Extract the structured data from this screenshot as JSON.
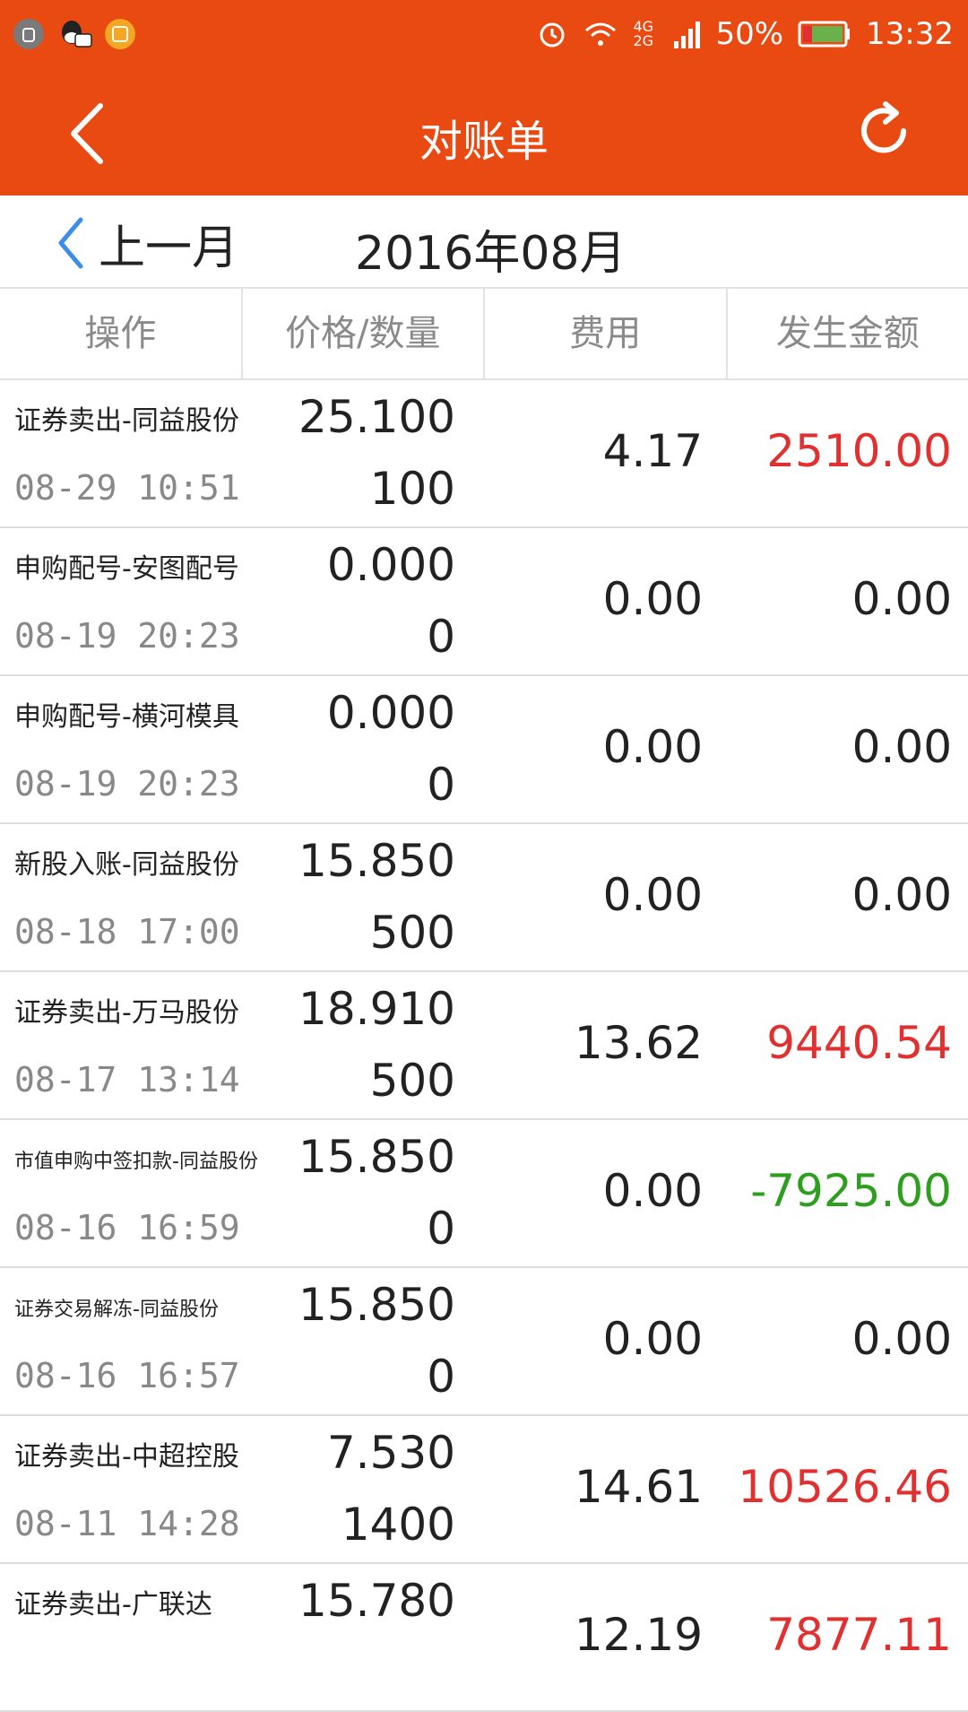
{
  "status_bar": {
    "battery": "50%",
    "time": "13:32",
    "network": "4G 2G",
    "icons": [
      "android-debug-icon",
      "qq-icon",
      "app-notification-icon",
      "alarm-icon",
      "wifi-icon",
      "signal-icon",
      "battery-icon"
    ]
  },
  "header": {
    "title": "对账单",
    "back_icon": "chevron-left-icon",
    "refresh_icon": "refresh-icon"
  },
  "month_nav": {
    "prev_label": "上一月",
    "current_month": "2016年08月"
  },
  "columns": [
    "操作",
    "价格/数量",
    "费用",
    "发生金额"
  ],
  "colors": {
    "accent": "#e84a12",
    "positive": "#e03030",
    "negative": "#2e9e1f",
    "neutral": "#222222",
    "nav_blue": "#3d8de8"
  },
  "rows": [
    {
      "op": "证券卖出-同益股份",
      "time": "08-29 10:51",
      "price": "25.100",
      "qty": "100",
      "fee": "4.17",
      "amount": "2510.00",
      "tone": "positive",
      "small": false
    },
    {
      "op": "申购配号-安图配号",
      "time": "08-19 20:23",
      "price": "0.000",
      "qty": "0",
      "fee": "0.00",
      "amount": "0.00",
      "tone": "neutral",
      "small": false
    },
    {
      "op": "申购配号-横河模具",
      "time": "08-19 20:23",
      "price": "0.000",
      "qty": "0",
      "fee": "0.00",
      "amount": "0.00",
      "tone": "neutral",
      "small": false
    },
    {
      "op": "新股入账-同益股份",
      "time": "08-18 17:00",
      "price": "15.850",
      "qty": "500",
      "fee": "0.00",
      "amount": "0.00",
      "tone": "neutral",
      "small": false
    },
    {
      "op": "证券卖出-万马股份",
      "time": "08-17 13:14",
      "price": "18.910",
      "qty": "500",
      "fee": "13.62",
      "amount": "9440.54",
      "tone": "positive",
      "small": false
    },
    {
      "op": "市值申购中签扣款-同益股份",
      "time": "08-16 16:59",
      "price": "15.850",
      "qty": "0",
      "fee": "0.00",
      "amount": "-7925.00",
      "tone": "negative",
      "small": true
    },
    {
      "op": "证券交易解冻-同益股份",
      "time": "08-16 16:57",
      "price": "15.850",
      "qty": "0",
      "fee": "0.00",
      "amount": "0.00",
      "tone": "neutral",
      "small": true
    },
    {
      "op": "证券卖出-中超控股",
      "time": "08-11 14:28",
      "price": "7.530",
      "qty": "1400",
      "fee": "14.61",
      "amount": "10526.46",
      "tone": "positive",
      "small": false
    },
    {
      "op": "证券卖出-广联达",
      "time": "",
      "price": "15.780",
      "qty": "",
      "fee": "12.19",
      "amount": "7877.11",
      "tone": "positive",
      "small": false
    }
  ]
}
